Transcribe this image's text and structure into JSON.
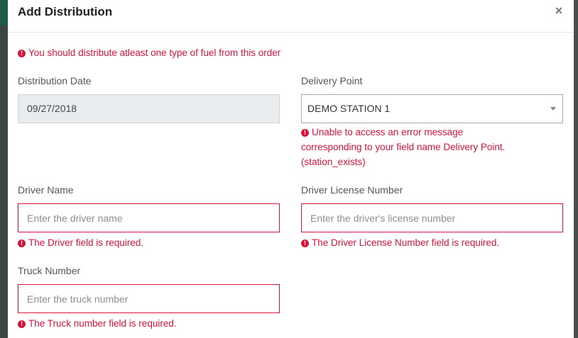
{
  "modal": {
    "title": "Add Distribution",
    "close_label": "×"
  },
  "form_error": "You should distribute atleast one type of fuel from this order",
  "error_icon": "!",
  "fields": {
    "distribution_date": {
      "label": "Distribution Date",
      "value": "09/27/2018"
    },
    "delivery_point": {
      "label": "Delivery Point",
      "selected": "DEMO STATION 1",
      "error_line1": "Unable to access an error message",
      "error_line2": "corresponding to your field name Delivery Point.",
      "error_line3": "(station_exists)"
    },
    "driver_name": {
      "label": "Driver Name",
      "placeholder": "Enter the driver name",
      "error": "The Driver field is required."
    },
    "driver_license": {
      "label": "Driver License Number",
      "placeholder": "Enter the driver's license number",
      "error": "The Driver License Number field is required."
    },
    "truck_number": {
      "label": "Truck Number",
      "placeholder": "Enter the truck number",
      "error": "The Truck number field is required."
    }
  },
  "colors": {
    "error": "#d9123c",
    "header_backdrop": "#1e5a46"
  },
  "icons": {
    "error": "exclamation-circle-icon",
    "close": "close-icon",
    "dropdown": "caret-down-icon"
  }
}
